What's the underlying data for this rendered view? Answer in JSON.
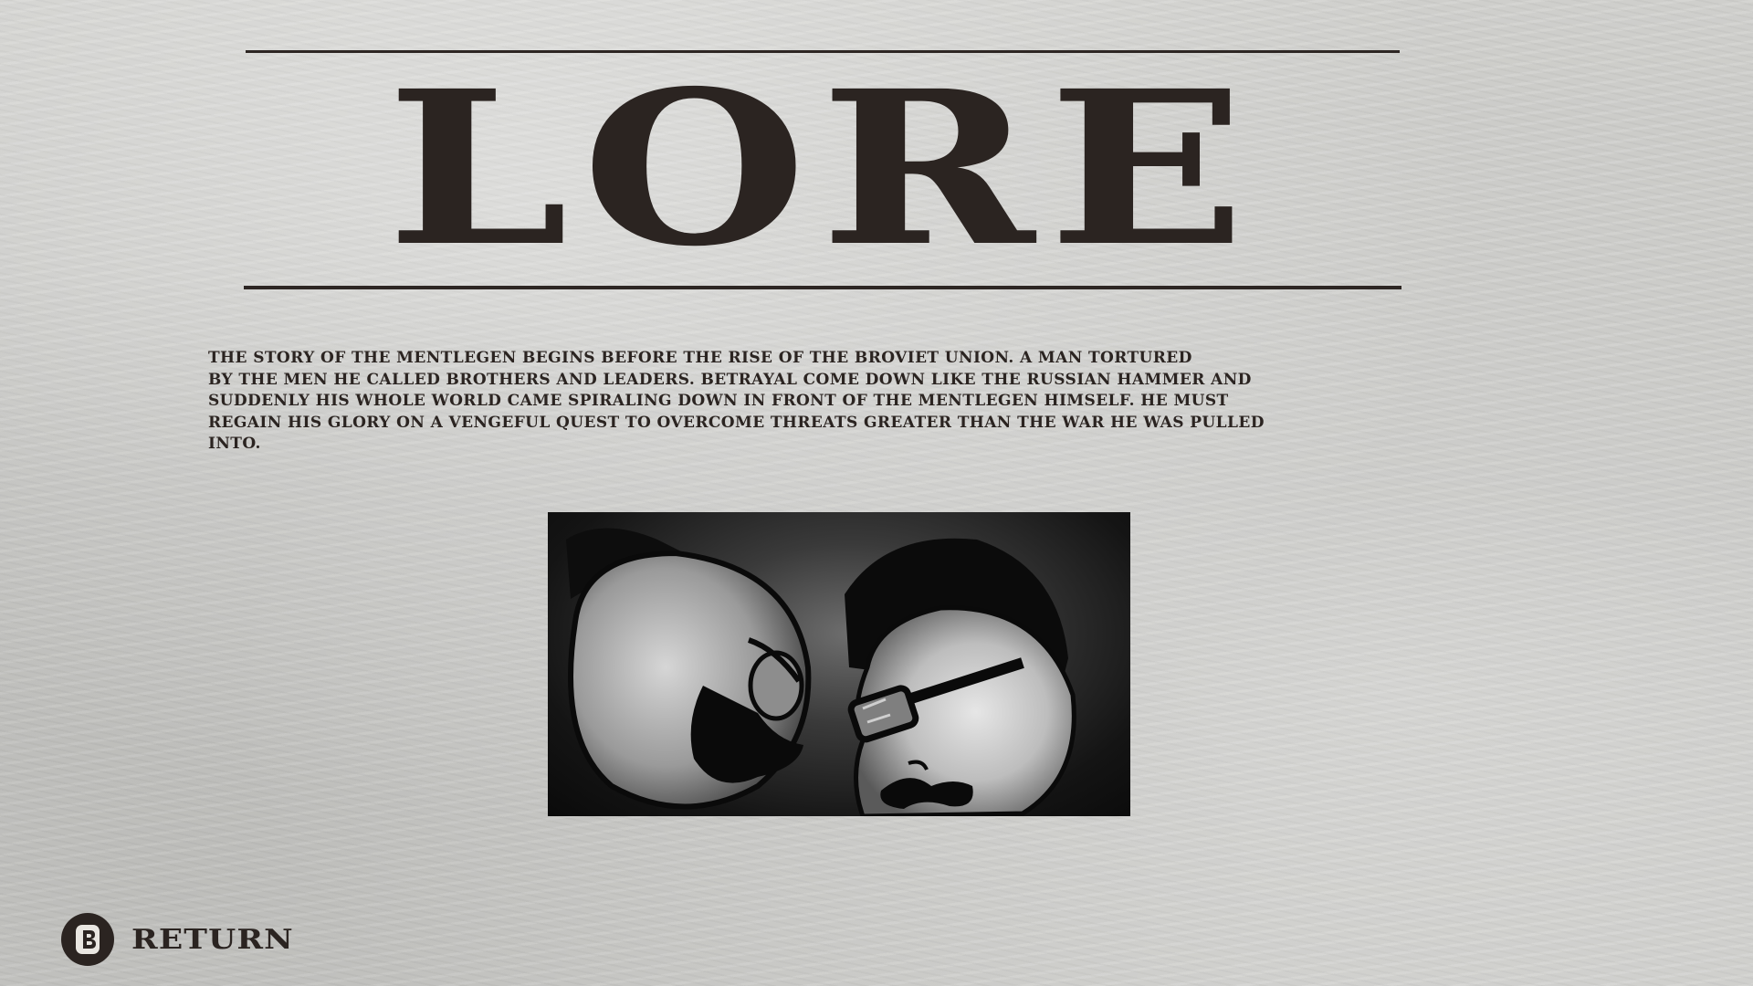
{
  "screen": {
    "title": "LORE",
    "story_text": "The story of the Mentlegen begins before the rise of the Broviet Union. A man tortured\nby the men he called brothers and leaders. Betrayal come down like the Russian hammer and\nsuddenly his whole world came spiraling down in front of the Mentlegen himself. He must\nregain his glory on a vengeful quest to overcome threats greater than the war he was pulled\ninto."
  },
  "artwork": {
    "description_icon": "lore-illustration-image"
  },
  "controls": {
    "return_button_glyph": "B",
    "return_label": "Return"
  },
  "colors": {
    "ink": "#2b2421",
    "paper": "#c9c9c6",
    "art_background": "#141414"
  }
}
